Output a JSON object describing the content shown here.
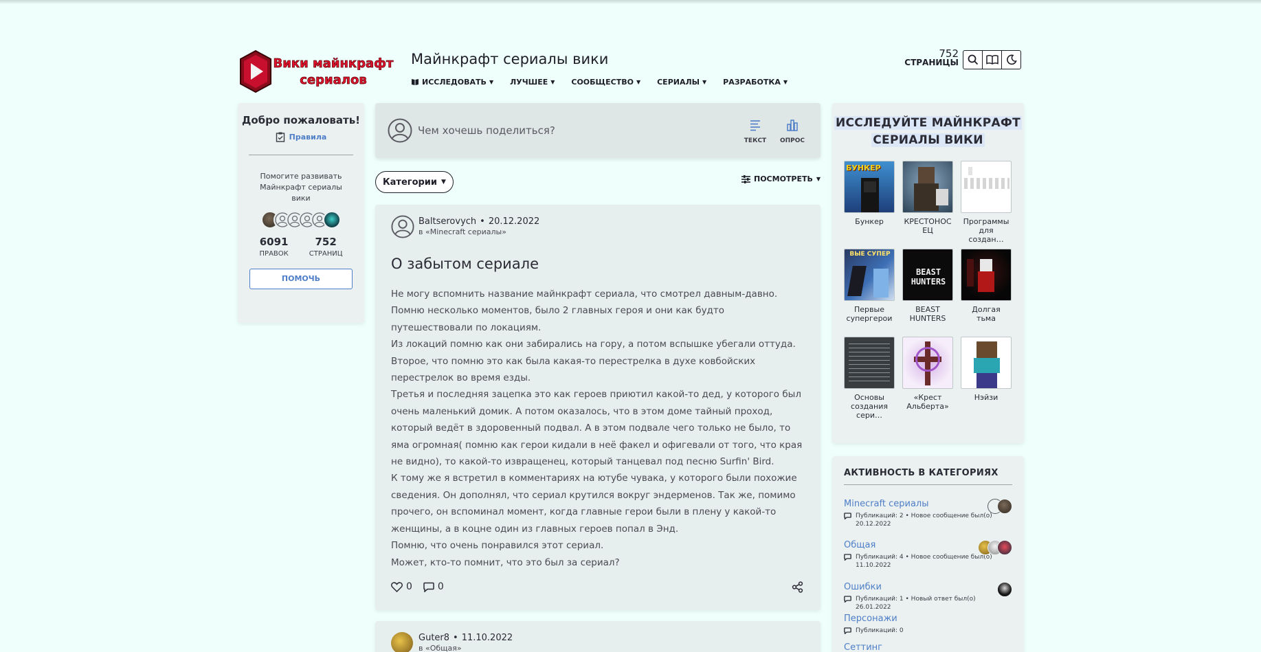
{
  "header": {
    "logo_text_line1": "Вики майнкрафт",
    "logo_text_line2": "сериалов",
    "site_title": "Майнкрафт сериалы вики",
    "nav": [
      {
        "label": "ИССЛЕДОВАТЬ"
      },
      {
        "label": "ЛУЧШЕЕ"
      },
      {
        "label": "СООБЩЕСТВО"
      },
      {
        "label": "СЕРИАЛЫ"
      },
      {
        "label": "РАЗРАБОТКА"
      }
    ],
    "pages_count": "752",
    "pages_label": "СТРАНИЦЫ"
  },
  "left_rail": {
    "welcome": "Добро пожаловать!",
    "rules": "Правила",
    "help_text": "Помогите развивать Майнкрафт сериалы вики",
    "edits_count": "6091",
    "edits_label": "ПРАВОК",
    "pages_count": "752",
    "pages_label": "СТРАНИЦ",
    "help_button": "ПОМОЧЬ"
  },
  "composer": {
    "placeholder": "Чем хочешь поделиться?",
    "text_label": "ТЕКСТ",
    "poll_label": "ОПРОС"
  },
  "filters": {
    "categories": "Категории",
    "view": "ПОСМОТРЕТЬ"
  },
  "post": {
    "author": "Baltserovych",
    "date": "20.12.2022",
    "category": "в «Minecraft сериалы»",
    "title": "О забытом сериале",
    "paragraphs": [
      "Не могу вспомнить название майнкрафт сериала, что смотрел давным-давно.",
      "Помню несколько моментов, было 2 главных героя и они как будто путешествовали по локациям.",
      "Из локаций помню как они забирались на гору, а потом вспышке убегали оттуда.",
      "Второе, что помню это как была какая-то перестрелка в духе ковбойских перестрелок во время езды.",
      "Третья и последняя зацепка это как героев приютил какой-то дед, у которого был очень маленький домик. А потом оказалось, что в этом доме тайный проход, который ведёт в здоровенный подвал. А в этом подвале чего только не было, то яма огромная( помню как герои кидали в неё факел и офигевали от того, что края не видно), то какой-то извращенец, который танцевал под песню Surfin' Bird.",
      "К тому же я встретил в комментариях на ютубе чувака, у которого были похожие сведения. Он дополнял, что сериал крутился вокруг эндерменов. Так же, помимо прочего, он вспоминал момент, когда главные герои были в плену у какой-то женщины, а в коцне один из главных героев попал в Энд.",
      "Помню, что очень понравился этот сериал.",
      "Может, кто-то помнит, что это был за сериал?"
    ],
    "likes": "0",
    "comments": "0"
  },
  "post2": {
    "author": "Guter8",
    "date": "11.10.2022",
    "category": "в «Общая»"
  },
  "explore": {
    "title_line1": "ИССЛЕДУЙТЕ МАЙНКРАФТ",
    "title_line2": "СЕРИАЛЫ ВИКИ",
    "tiles": [
      {
        "caption": "Бункер",
        "thumb_text": "БУНКЕР"
      },
      {
        "caption": "КРЕСТОНОС ЕЦ",
        "thumb_text": ""
      },
      {
        "caption": "Программы для создан…",
        "thumb_text": ""
      },
      {
        "caption": "Первые супергерои",
        "thumb_text": "ВЫЕ СУПЕР"
      },
      {
        "caption": "BEAST HUNTERS",
        "thumb_text": "BEAST HUNTERS"
      },
      {
        "caption": "Долгая тьма",
        "thumb_text": ""
      },
      {
        "caption": "Основы создания сери…",
        "thumb_text": ""
      },
      {
        "caption": "«Крест Альберта»",
        "thumb_text": ""
      },
      {
        "caption": "Нэйзи",
        "thumb_text": ""
      }
    ]
  },
  "activity": {
    "title": "АКТИВНОСТЬ В КАТЕГОРИЯХ",
    "items": [
      {
        "name": "Minecraft сериалы",
        "meta": "Публикаций: 2 • Новое сообщение был(о) 20.12.2022"
      },
      {
        "name": "Общая",
        "meta": "Публикаций: 4 • Новое сообщение был(о) 11.10.2022"
      },
      {
        "name": "Ошибки",
        "meta": "Публикаций: 1 • Новый ответ был(о) 26.01.2022"
      },
      {
        "name": "Персонажи",
        "meta": "Публикаций: 0"
      },
      {
        "name": "Сеттинг",
        "meta": ""
      }
    ]
  },
  "colors": {
    "page_bg": "#effffb",
    "link": "#4f7ec8",
    "text": "#2b2b35",
    "logo_red": "#c8102e"
  }
}
